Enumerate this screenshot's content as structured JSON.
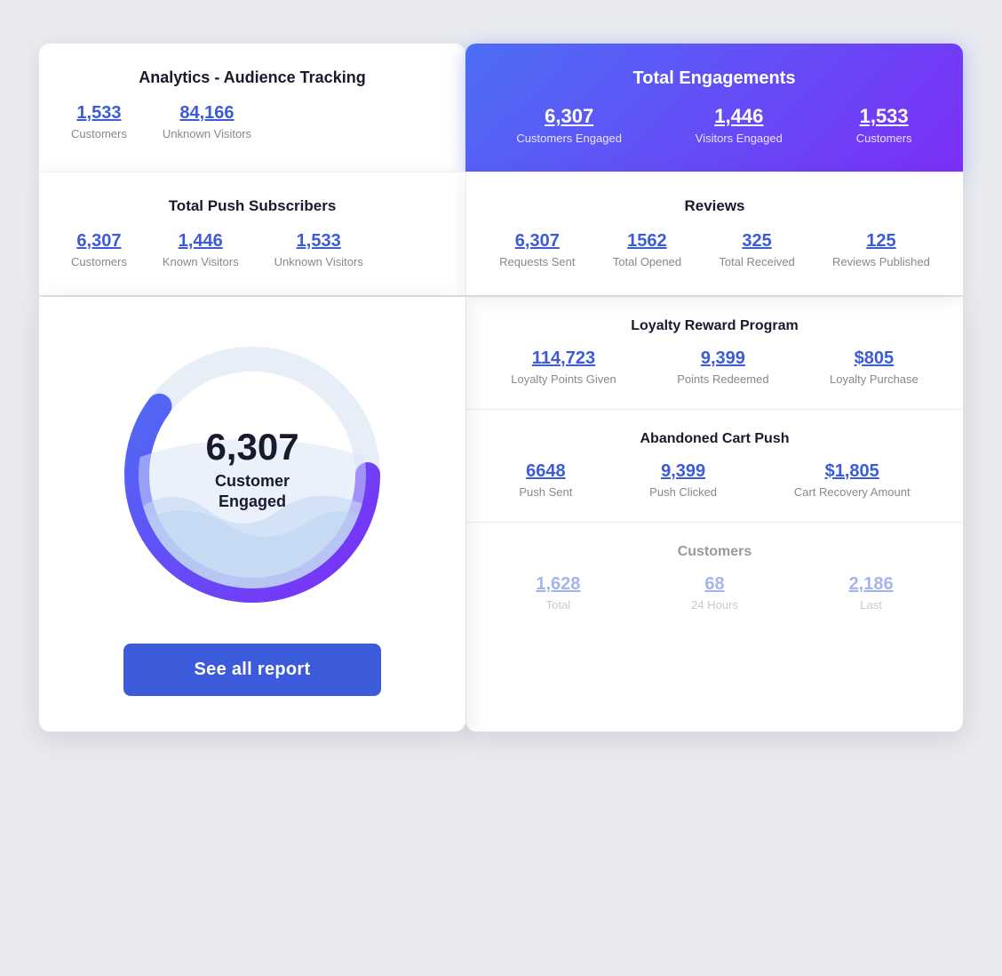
{
  "analytics": {
    "title": "Analytics - Audience Tracking",
    "customers_value": "1,533",
    "customers_label": "Customers",
    "unknown_visitors_value": "84,166",
    "unknown_visitors_label": "Unknown Visitors"
  },
  "engagements": {
    "title": "Total Engagements",
    "items": [
      {
        "value": "6,307",
        "label": "Customers Engaged"
      },
      {
        "value": "1,446",
        "label": "Visitors Engaged"
      },
      {
        "value": "1,533",
        "label": "Customers"
      }
    ]
  },
  "push_subscribers": {
    "title": "Total Push Subscribers",
    "items": [
      {
        "value": "6,307",
        "label": "Customers"
      },
      {
        "value": "1,446",
        "label": "Known Visitors"
      },
      {
        "value": "1,533",
        "label": "Unknown Visitors"
      }
    ]
  },
  "reviews": {
    "title": "Reviews",
    "items": [
      {
        "value": "6,307",
        "label": "Requests Sent"
      },
      {
        "value": "1562",
        "label": "Total Opened"
      },
      {
        "value": "325",
        "label": "Total Received"
      },
      {
        "value": "125",
        "label": "Reviews Published"
      }
    ]
  },
  "donut": {
    "number": "6,307",
    "label": "Customer\nEngaged"
  },
  "see_all_button": "See all report",
  "loyalty": {
    "title": "Loyalty Reward Program",
    "items": [
      {
        "value": "114,723",
        "label": "Loyalty Points Given"
      },
      {
        "value": "9,399",
        "label": "Points Redeemed"
      },
      {
        "value": "$805",
        "label": "Loyalty Purchase"
      }
    ]
  },
  "abandoned_cart": {
    "title": "Abandoned Cart Push",
    "items": [
      {
        "value": "6648",
        "label": "Push Sent"
      },
      {
        "value": "9,399",
        "label": "Push Clicked"
      },
      {
        "value": "$1,805",
        "label": "Cart Recovery Amount"
      }
    ]
  },
  "customers_section": {
    "title": "Customers",
    "items": [
      {
        "value": "1,628",
        "label": "Total"
      },
      {
        "value": "68",
        "label": "24 Hours"
      },
      {
        "value": "2,186",
        "label": "Last"
      }
    ]
  }
}
